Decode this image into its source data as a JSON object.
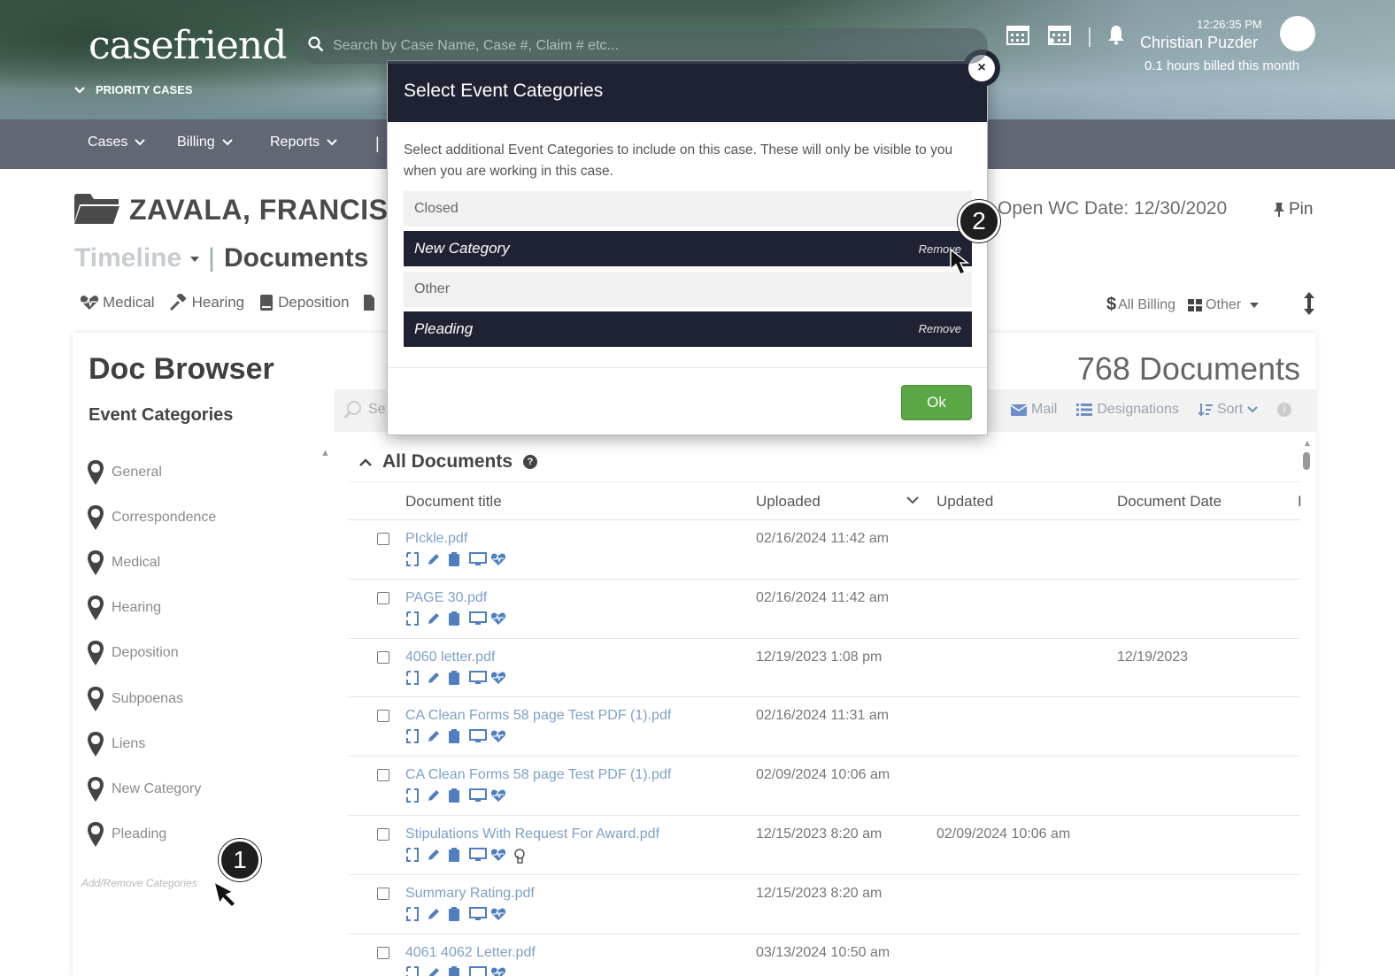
{
  "app": {
    "logo": "casefriend",
    "priority_label": "PRIORITY CASES",
    "search_placeholder": "Search by Case Name, Case #, Claim # etc...",
    "time": "12:26:35 PM",
    "user_name": "Christian Puzder",
    "billed": "0.1 hours billed this month"
  },
  "nav": {
    "items": [
      {
        "label": "Cases"
      },
      {
        "label": "Billing"
      },
      {
        "label": "Reports"
      }
    ],
    "separator": "|"
  },
  "case": {
    "name": "ZAVALA, FRANCIS",
    "open_wc": "Open WC Date:  12/30/2020",
    "pin_label": "Pin",
    "tab_timeline": "Timeline",
    "tab_separator": "|",
    "tab_documents": "Documents",
    "filters": [
      "Medical",
      "Hearing",
      "Deposition"
    ],
    "right_filters": {
      "billing": "All Billing",
      "other": "Other"
    }
  },
  "browser": {
    "title": "Doc Browser",
    "event_categories_title": "Event Categories",
    "categories": [
      "General",
      "Correspondence",
      "Medical",
      "Hearing",
      "Deposition",
      "Subpoenas",
      "Liens",
      "New Category",
      "Pleading"
    ],
    "add_remove": "Add/Remove Categories",
    "docs_count": "768 Documents",
    "search_placeholder": "Se",
    "toolbar": {
      "mail": "Mail",
      "designations": "Designations",
      "sort": "Sort"
    },
    "section_title": "All Documents",
    "columns": {
      "title": "Document title",
      "uploaded": "Uploaded",
      "updated": "Updated",
      "doc_date": "Document Date",
      "more": "I"
    },
    "rows": [
      {
        "title": "PIckle.pdf",
        "uploaded": "02/16/2024 11:42 am",
        "updated": "",
        "doc_date": ""
      },
      {
        "title": "PAGE 30.pdf",
        "uploaded": "02/16/2024 11:42 am",
        "updated": "",
        "doc_date": ""
      },
      {
        "title": "4060 letter.pdf",
        "uploaded": "12/19/2023 1:08 pm",
        "updated": "",
        "doc_date": "12/19/2023"
      },
      {
        "title": "CA Clean Forms 58 page Test PDF (1).pdf",
        "uploaded": "02/16/2024 11:31 am",
        "updated": "",
        "doc_date": ""
      },
      {
        "title": "CA Clean Forms 58 page Test PDF (1).pdf",
        "uploaded": "02/09/2024 10:06 am",
        "updated": "",
        "doc_date": ""
      },
      {
        "title": "Stipulations With Request For Award.pdf",
        "uploaded": "12/15/2023 8:20 am",
        "updated": "02/09/2024 10:06 am",
        "doc_date": ""
      },
      {
        "title": "Summary Rating.pdf",
        "uploaded": "12/15/2023 8:20 am",
        "updated": "",
        "doc_date": ""
      },
      {
        "title": "4061 4062 Letter.pdf",
        "uploaded": "03/13/2024 10:50 am",
        "updated": "",
        "doc_date": ""
      }
    ]
  },
  "modal": {
    "title": "Select Event Categories",
    "description": "Select additional Event Categories to include on this case. These will only be visible to you when you are working in this case.",
    "items": [
      {
        "label": "Closed",
        "selected": false,
        "action": ""
      },
      {
        "label": "New Category",
        "selected": true,
        "action": "Remove"
      },
      {
        "label": "Other",
        "selected": false,
        "action": ""
      },
      {
        "label": "Pleading",
        "selected": true,
        "action": "Remove"
      }
    ],
    "ok_label": "Ok",
    "close_symbol": "×"
  },
  "steps": {
    "one": "1",
    "two": "2"
  },
  "colors": {
    "navy": "#1f2233",
    "ok_green": "#5ba745",
    "link_blue": "#7ea1c8",
    "nav_gray": "#626774"
  }
}
